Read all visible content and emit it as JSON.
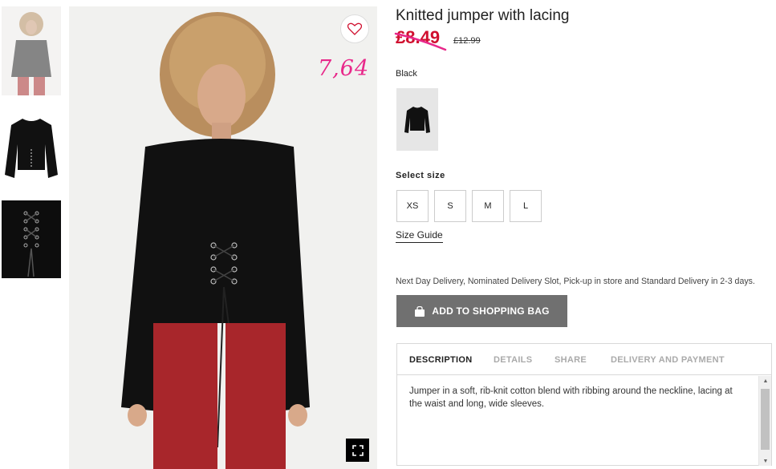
{
  "product": {
    "title": "Knitted jumper with lacing",
    "price": "£8.49",
    "old_price": "£12.99",
    "handwritten_note": "7,64",
    "color_name": "Black"
  },
  "sizes": {
    "label": "Select size",
    "options": [
      "XS",
      "S",
      "M",
      "L"
    ],
    "guide_label": "Size Guide"
  },
  "delivery_text": "Next Day Delivery, Nominated Delivery Slot, Pick-up in store and Standard Delivery in 2-3 days.",
  "bag_button_label": "ADD TO SHOPPING BAG",
  "tabs": [
    "DESCRIPTION",
    "DETAILS",
    "SHARE",
    "DELIVERY AND PAYMENT"
  ],
  "description": "Jumper in a soft, rib-knit cotton blend with ribbing around the neckline, lacing at the waist and long, wide sleeves.",
  "colors": {
    "price_red": "#d0102f",
    "note_pink": "#e8288a",
    "button_gray": "#707070"
  },
  "icons": {
    "favorite": "heart-icon",
    "zoom": "expand-icon",
    "bag": "shopping-bag-icon"
  }
}
